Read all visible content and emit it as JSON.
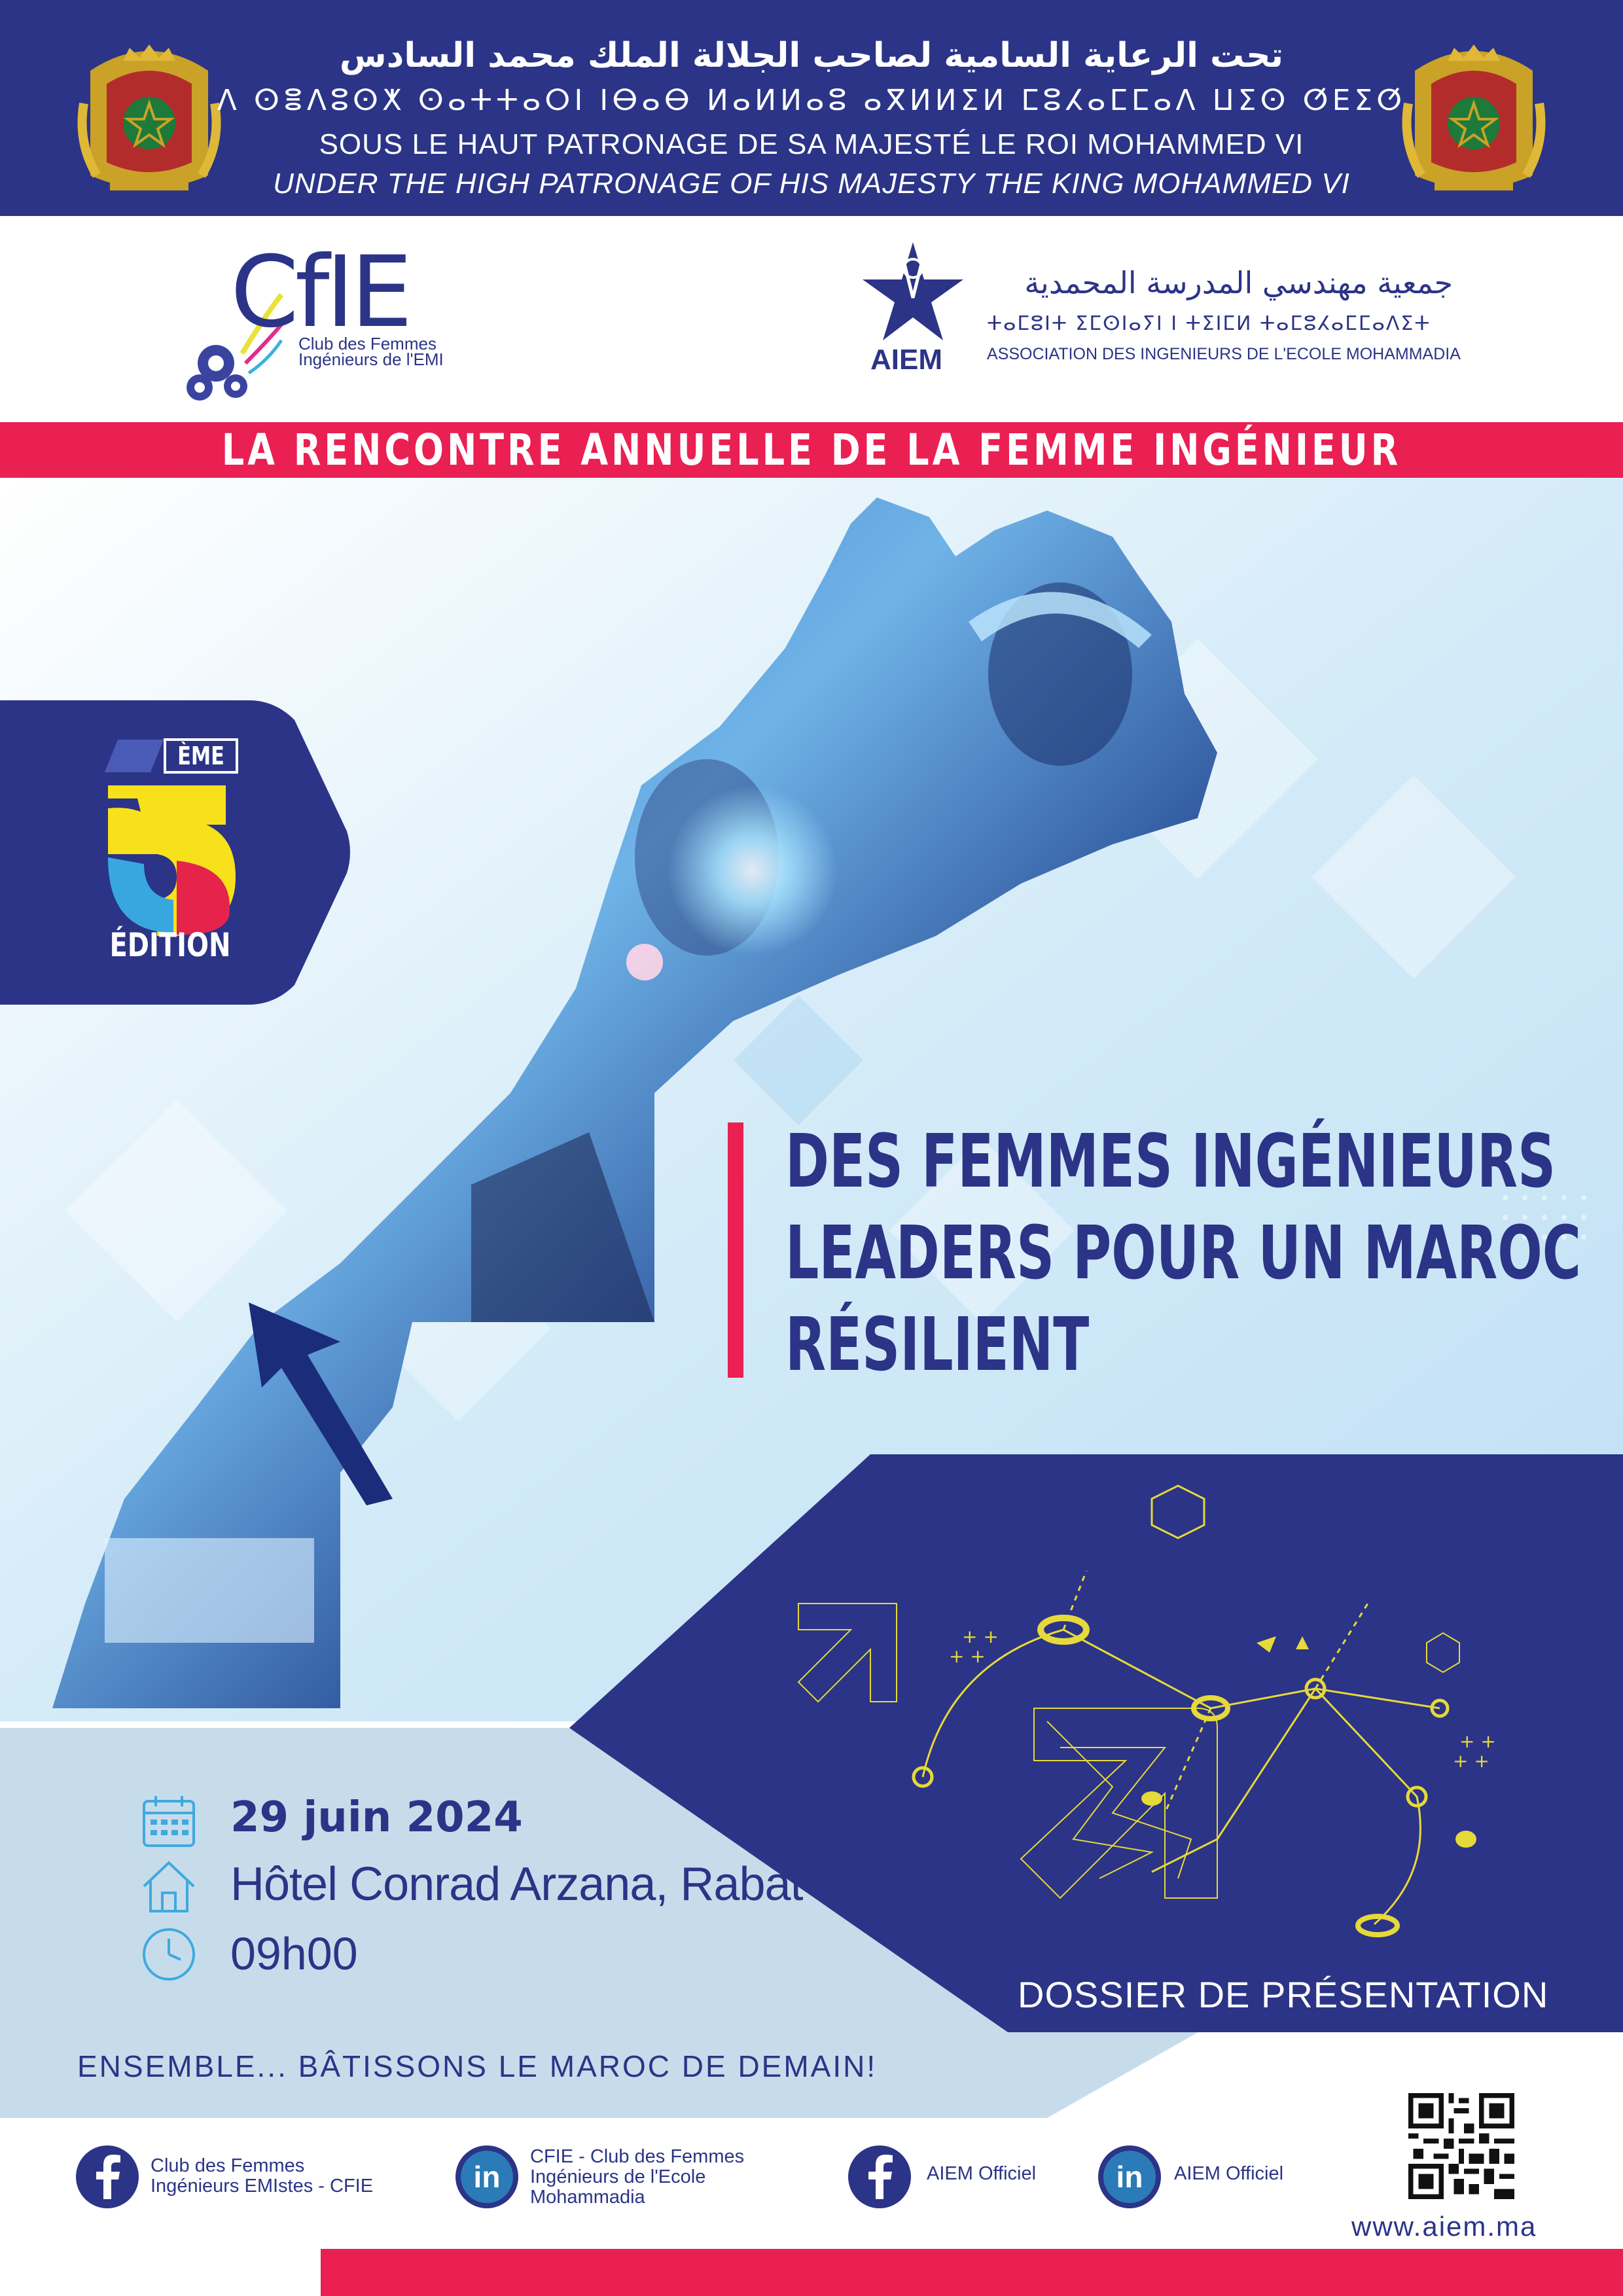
{
  "header": {
    "arabic_line": "تحت الرعاية السامية لصاحب الجلالة الملك محمد السادس",
    "tifinagh_line": "ⴷ ⵙⴻⴷⵓⵙⵅ ⵙⴰⵜⵜⴰⵔⵏ ⵏⴱⴰⴱ ⵍⴰⵍⵍⴰⵓ ⴰⴳⵍⵍⵉⵍ ⵎⵓⵃⴰⵎⵎⴰⴷ ⵡⵉⵙ ⵚⴹⵉⵚ",
    "french_line": "SOUS LE HAUT PATRONAGE DE SA MAJESTÉ LE ROI MOHAMMED VI",
    "english_line": "UNDER THE HIGH PATRONAGE OF HIS MAJESTY THE KING MOHAMMED VI"
  },
  "logos": {
    "cfie": {
      "mark": "CfIE",
      "subtitle_1": "Club des Femmes",
      "subtitle_2": "Ingénieurs de l'EMI"
    },
    "aiem": {
      "mark": "AIEM",
      "arabic": "جمعية مهندسي المدرسة المحمدية",
      "tifinagh": "ⵜⴰⵎⵓⵏⵜ ⵉⵎⵙⵏⴰⵢⵏ ⵏ ⵜⵉⵏⵎⵍ ⵜⴰⵎⵓⵃⴰⵎⵎⴰⴷⵉⵜ",
      "french": "ASSOCIATION DES INGENIEURS DE L'ECOLE MOHAMMADIA"
    }
  },
  "annual_title": "LA RENCONTRE ANNUELLE DE LA FEMME INGÉNIEUR",
  "edition": {
    "suffix": "ÈME",
    "label": "ÉDITION"
  },
  "theme_lines": [
    "DES FEMMES INGÉNIEURS",
    "LEADERS POUR UN MAROC",
    "RÉSILIENT"
  ],
  "info": {
    "date": "29 juin 2024",
    "venue": "Hôtel Conrad Arzana, Rabat",
    "time": "09h00"
  },
  "slogan": "ENSEMBLE... BÂTISSONS LE MAROC DE DEMAIN!",
  "dossier": "DOSSIER DE PRÉSENTATION",
  "footer": {
    "social": [
      {
        "network": "facebook",
        "line1": "Club des Femmes",
        "line2": "Ingénieurs EMIstes - CFIE",
        "line3": ""
      },
      {
        "network": "linkedin",
        "line1": "CFIE - Club des Femmes",
        "line2": "Ingénieurs de l'Ecole",
        "line3": "Mohammadia"
      },
      {
        "network": "facebook",
        "line1": "AIEM Officiel",
        "line2": "",
        "line3": ""
      },
      {
        "network": "linkedin",
        "line1": "AIEM Officiel",
        "line2": "",
        "line3": ""
      }
    ],
    "website": "www.aiem.ma"
  },
  "colors": {
    "navy": "#2b3486",
    "pink": "#ea1f52",
    "light_blue": "#cfe6f4",
    "gold": "#e6d93a"
  }
}
